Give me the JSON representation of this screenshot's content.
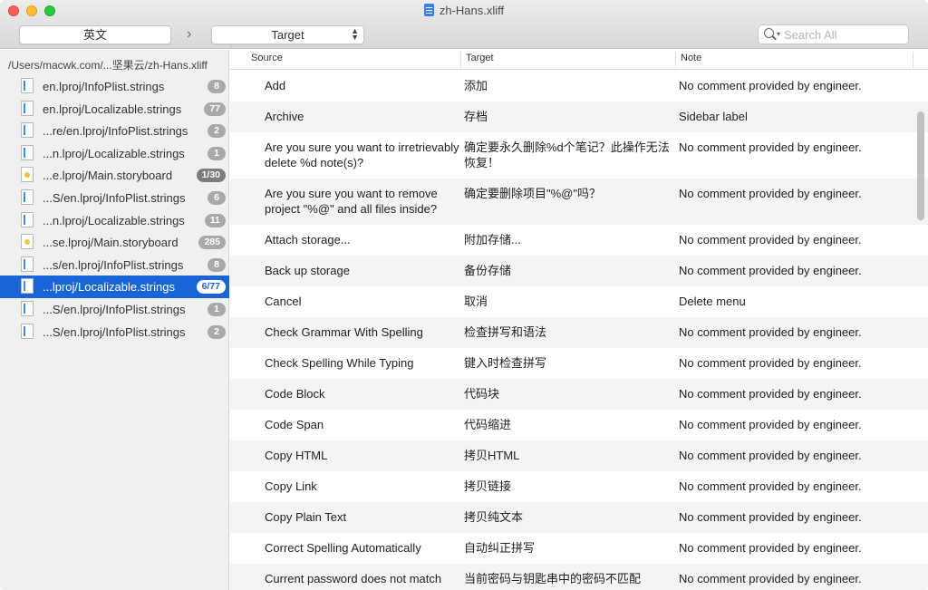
{
  "window": {
    "title": "zh-Hans.xliff",
    "icon": "xliff-document-icon"
  },
  "toolbar": {
    "source_language": "英文",
    "chevron": "›",
    "target_selector": "Target",
    "search_placeholder": "Search All"
  },
  "sidebar": {
    "path": "/Users/macwk.com/...坚果云/zh-Hans.xliff",
    "items": [
      {
        "label": "en.lproj/InfoPlist.strings",
        "badge": "8",
        "type": "strings"
      },
      {
        "label": "en.lproj/Localizable.strings",
        "badge": "77",
        "type": "strings"
      },
      {
        "label": "...re/en.lproj/InfoPlist.strings",
        "badge": "2",
        "type": "strings"
      },
      {
        "label": "...n.lproj/Localizable.strings",
        "badge": "1",
        "type": "strings"
      },
      {
        "label": "...e.lproj/Main.storyboard",
        "badge": "1/30",
        "type": "storyboard"
      },
      {
        "label": "...S/en.lproj/InfoPlist.strings",
        "badge": "6",
        "type": "strings"
      },
      {
        "label": "...n.lproj/Localizable.strings",
        "badge": "11",
        "type": "strings"
      },
      {
        "label": "...se.lproj/Main.storyboard",
        "badge": "285",
        "type": "storyboard"
      },
      {
        "label": "...s/en.lproj/InfoPlist.strings",
        "badge": "8",
        "type": "strings"
      },
      {
        "label": "...lproj/Localizable.strings",
        "badge": "6/77",
        "type": "strings",
        "selected": true
      },
      {
        "label": "...S/en.lproj/InfoPlist.strings",
        "badge": "1",
        "type": "strings"
      },
      {
        "label": "...S/en.lproj/InfoPlist.strings",
        "badge": "2",
        "type": "strings"
      }
    ]
  },
  "table": {
    "columns": [
      "Source",
      "Target",
      "Note"
    ],
    "rows": [
      {
        "source": "Add",
        "target": "添加",
        "note": "No comment provided by engineer."
      },
      {
        "source": "Archive",
        "target": "存档",
        "note": "Sidebar label"
      },
      {
        "source": "Are you sure you want to irretrievably delete %d note(s)?",
        "target": "确定要永久删除%d个笔记？此操作无法恢复！",
        "note": "No comment provided by engineer."
      },
      {
        "source": "Are you sure you want to remove project \"%@\" and all files inside?",
        "target": "确定要删除项目\"%@\"吗？",
        "note": "No comment provided by engineer."
      },
      {
        "source": "Attach storage...",
        "target": "附加存储...",
        "note": "No comment provided by engineer."
      },
      {
        "source": "Back up storage",
        "target": "备份存储",
        "note": "No comment provided by engineer."
      },
      {
        "source": "Cancel",
        "target": "取消",
        "note": "Delete menu"
      },
      {
        "source": "Check Grammar With Spelling",
        "target": "检查拼写和语法",
        "note": "No comment provided by engineer."
      },
      {
        "source": "Check Spelling While Typing",
        "target": "键入时检查拼写",
        "note": "No comment provided by engineer."
      },
      {
        "source": "Code Block",
        "target": "代码块",
        "note": "No comment provided by engineer."
      },
      {
        "source": "Code Span",
        "target": "代码缩进",
        "note": "No comment provided by engineer."
      },
      {
        "source": "Copy HTML",
        "target": "拷贝HTML",
        "note": "No comment provided by engineer."
      },
      {
        "source": "Copy Link",
        "target": "拷贝链接",
        "note": "No comment provided by engineer."
      },
      {
        "source": "Copy Plain Text",
        "target": "拷贝纯文本",
        "note": "No comment provided by engineer."
      },
      {
        "source": "Correct Spelling Automatically",
        "target": "自动纠正拼写",
        "note": "No comment provided by engineer."
      },
      {
        "source": "Current password does not match",
        "target": "当前密码与钥匙串中的密码不匹配",
        "note": "No comment provided by engineer."
      }
    ]
  }
}
